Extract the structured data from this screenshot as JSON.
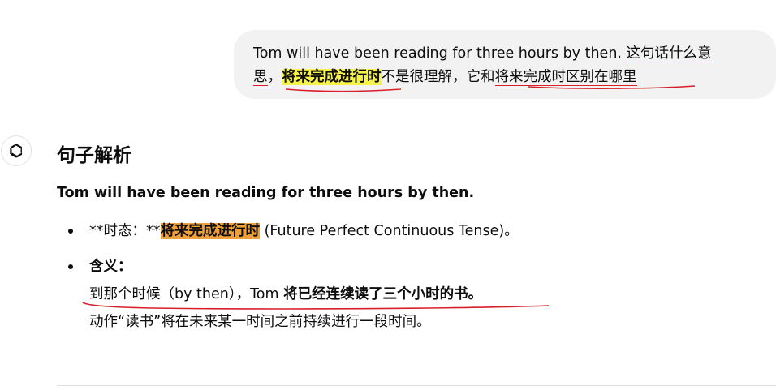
{
  "user_message": {
    "line1_a": "Tom will have been reading for three hours by then. ",
    "line1_b": "这句话什么意",
    "line2_a": "思",
    "line2_b": "，",
    "line2_hl": "将来完成进行时",
    "line2_c": "不是很理解，它和",
    "line2_d": "将来完成时区别在哪里"
  },
  "assistant": {
    "heading": "句子解析",
    "sentence": "Tom will have been reading for three hours by then.",
    "item1": {
      "prefix": "**时态：**",
      "highlight": "将来完成进行时",
      "suffix": " (Future Perfect Continuous Tense)。"
    },
    "item2": {
      "title": "含义：",
      "line1_a": "到那个时候（by then），Tom ",
      "line1_b": "将已经连续读了三个小时的书。",
      "line2": "动作“读书”将在未来某一时间之前持续进行一段时间。"
    }
  },
  "colors": {
    "bubble": "#f2f2f2",
    "highlight_yellow": "#f7f34a",
    "highlight_orange": "#f0a03a",
    "annotation_red": "#d81f2a"
  }
}
